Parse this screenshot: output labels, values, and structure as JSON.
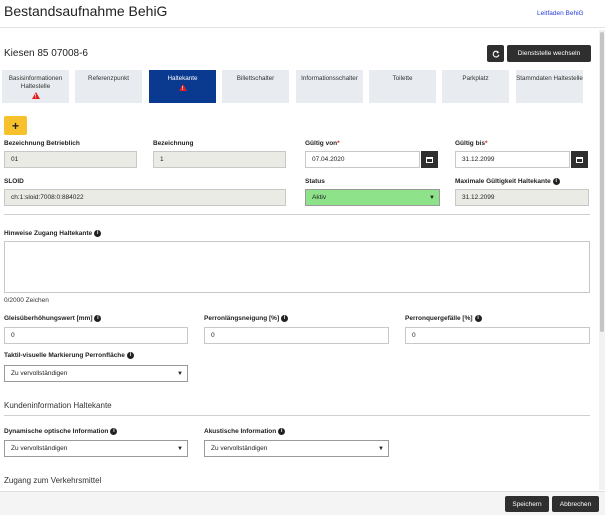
{
  "header": {
    "title": "Bestandsaufnahme BehiG",
    "help_link": "Leitfaden BehiG"
  },
  "stop": {
    "name": "Kiesen 85 07008-6",
    "change_button": "Dienststelle wechseln",
    "refresh_icon": "refresh-icon"
  },
  "tabs": [
    {
      "label": "Basisinformationen Haltestelle",
      "warning": true,
      "active": false
    },
    {
      "label": "Referenzpunkt",
      "warning": false,
      "active": false
    },
    {
      "label": "Haltekante",
      "warning": true,
      "active": true
    },
    {
      "label": "Billettschalter",
      "warning": false,
      "active": false
    },
    {
      "label": "Informationsschalter",
      "warning": false,
      "active": false
    },
    {
      "label": "Toilette",
      "warning": false,
      "active": false
    },
    {
      "label": "Parkplatz",
      "warning": false,
      "active": false
    },
    {
      "label": "Stammdaten Haltestelle",
      "warning": false,
      "active": false
    }
  ],
  "add_button": "+",
  "form": {
    "bezeichnung_betrieblich": {
      "label": "Bezeichnung Betrieblich",
      "value": "01"
    },
    "bezeichnung": {
      "label": "Bezeichnung",
      "value": "1"
    },
    "gueltig_von": {
      "label": "Gültig von",
      "required": "*",
      "value": "07.04.2020"
    },
    "gueltig_bis": {
      "label": "Gültig bis",
      "required": "*",
      "value": "31.12.2099"
    },
    "sloid": {
      "label": "SLOID",
      "value": "ch:1:sloid:7008:0:884022"
    },
    "status": {
      "label": "Status",
      "value": "Aktiv"
    },
    "max_gueltigkeit": {
      "label": "Maximale Gültigkeit Haltekante",
      "value": "31.12.2099"
    },
    "hinweise": {
      "label": "Hinweise Zugang Haltekante",
      "value": "",
      "counter": "0/2000 Zeichen"
    },
    "gleis": {
      "label": "Gleisüberhöhungswert [mm]",
      "value": "0"
    },
    "perronlaengs": {
      "label": "Perronlängsneigung [%]",
      "value": "0"
    },
    "perronquer": {
      "label": "Perronquergefälle [%]",
      "value": "0"
    },
    "taktil": {
      "label": "Taktil-visuelle Markierung Perronfläche",
      "value": "Zu vervollständigen"
    }
  },
  "section_kunden": {
    "title": "Kundeninformation Haltekante",
    "dyn_optisch": {
      "label": "Dynamische optische Information",
      "value": "Zu vervollständigen"
    },
    "akustisch": {
      "label": "Akustische Information",
      "value": "Zu vervollständigen"
    }
  },
  "section_zugang": {
    "title": "Zugang zum Verkehrsmittel"
  },
  "footer": {
    "save": "Speichern",
    "cancel": "Abbrechen"
  },
  "colors": {
    "active_tab": "#0a3a8f",
    "tab_bg": "#e8ebf0",
    "add_button": "#f6c12a",
    "status_active": "#8ee28a",
    "warning": "#e02020"
  }
}
